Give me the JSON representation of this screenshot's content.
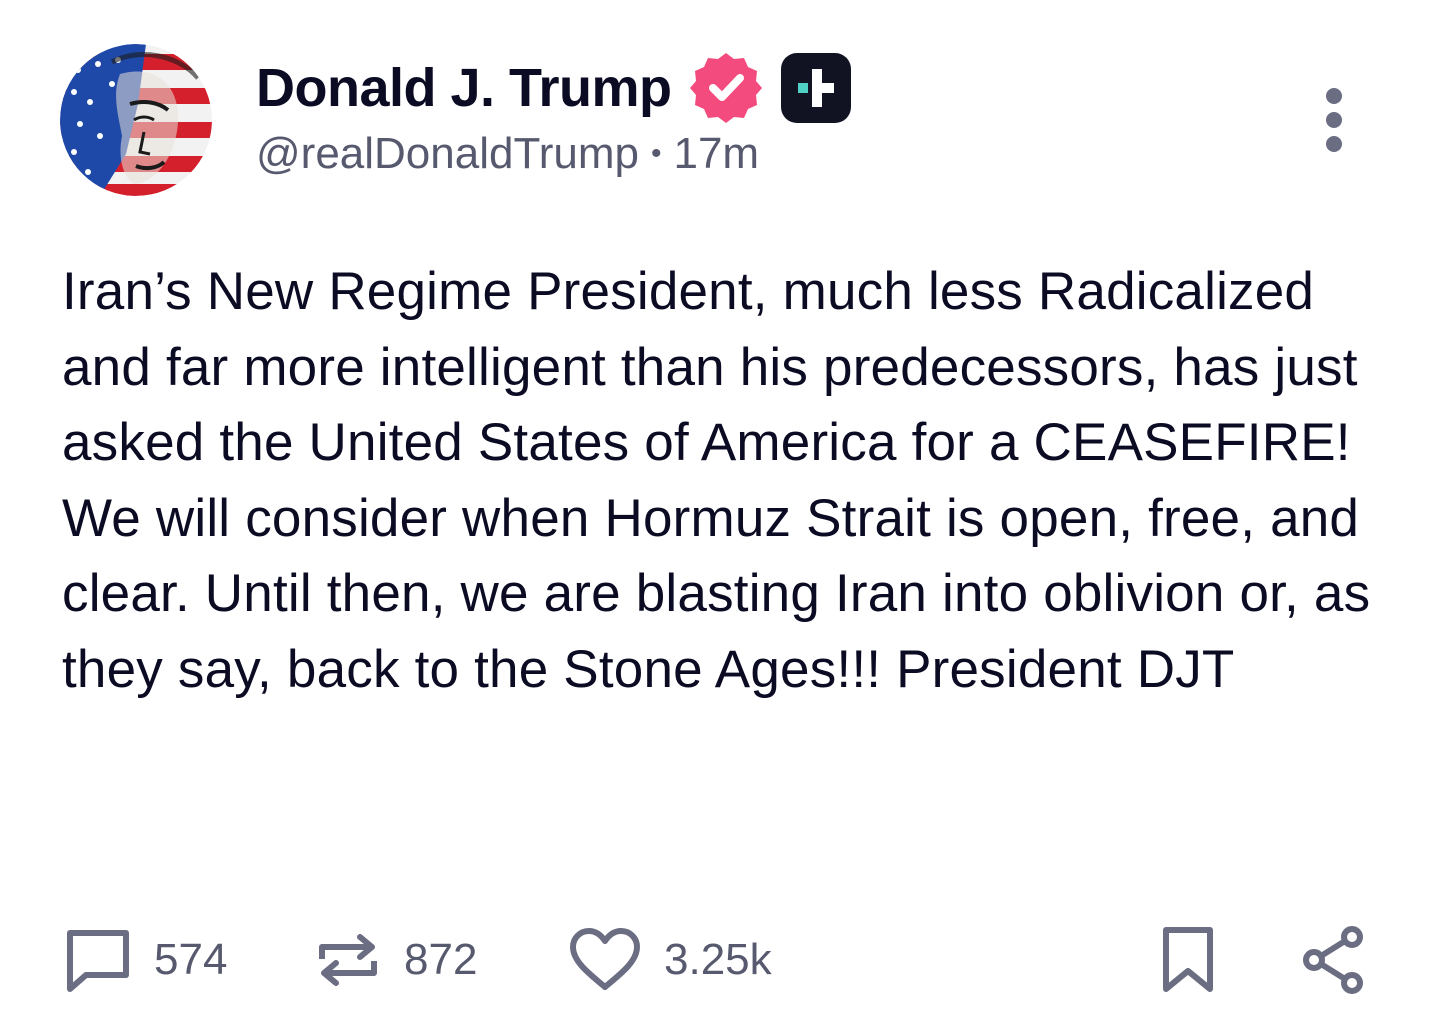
{
  "author": {
    "display_name": "Donald J. Trump",
    "handle": "@realDonaldTrump",
    "time_ago": "17m",
    "meta_separator": "•"
  },
  "post": {
    "text": "Iran’s New Regime President, much less Radicalized and far more intelligent than his predecessors, has just asked the United States of America for a CEASEFIRE! We will consider when Hormuz Strait is open, free, and clear. Until then, we are blasting Iran into oblivion or, as they say, back to the Stone Ages!!! President DJT"
  },
  "actions": {
    "replies": "574",
    "reposts": "872",
    "likes": "3.25k"
  },
  "icons": {
    "verified": "verified-badge-icon",
    "plus": "plus-badge-icon",
    "more": "more-options-icon",
    "reply": "reply-icon",
    "repost": "repost-icon",
    "like": "heart-icon",
    "bookmark": "bookmark-icon",
    "share": "share-icon"
  },
  "colors": {
    "text_primary": "#0b0c24",
    "text_secondary": "#575a6e",
    "verified_pink": "#f34b7d",
    "badge_dark": "#111322",
    "badge_teal": "#4fd1c5",
    "icon_gray": "#6b6d82"
  }
}
